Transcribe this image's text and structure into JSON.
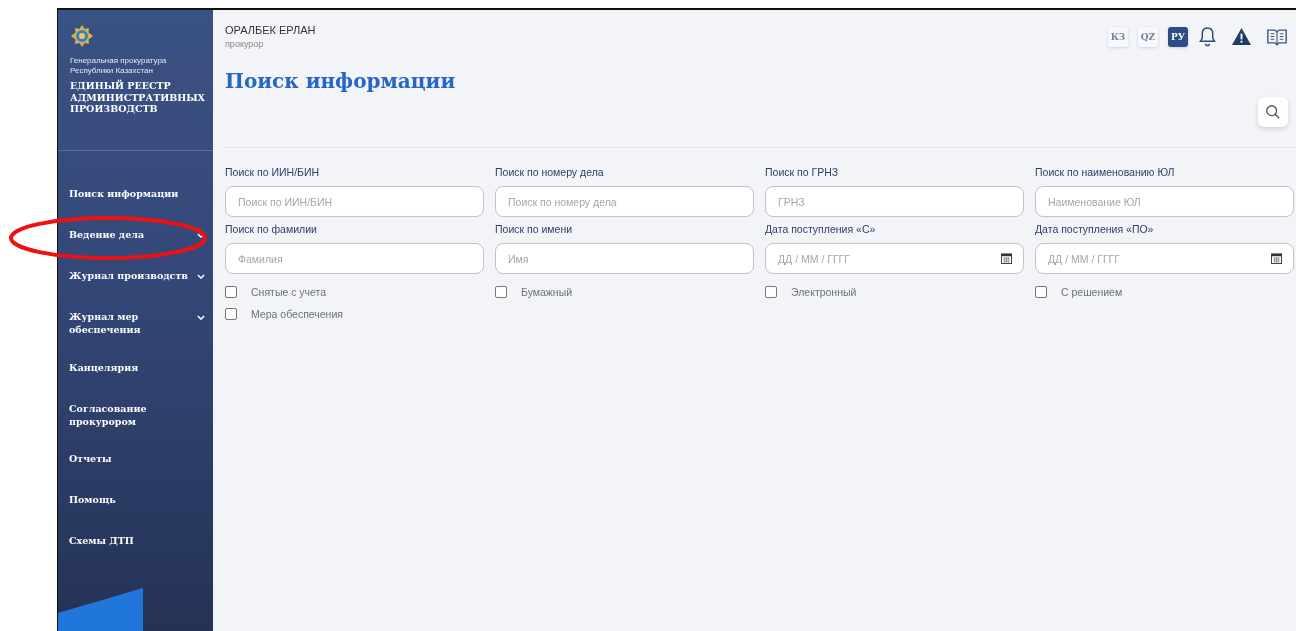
{
  "sidebar": {
    "org": "Генеральная прокуратура Республики Казахстан",
    "system": "ЕДИНЫЙ РЕЕСТР АДМИНИСТРАТИВНЫХ ПРОИЗВОДСТВ",
    "items": [
      {
        "label": "Поиск информации",
        "expandable": false,
        "annotated": false
      },
      {
        "label": "Ведение дела",
        "expandable": true,
        "annotated": true
      },
      {
        "label": "Журнал производств",
        "expandable": true,
        "annotated": false
      },
      {
        "label": "Журнал мер обеспечения",
        "expandable": true,
        "annotated": false
      },
      {
        "label": "Канцелярия",
        "expandable": false,
        "annotated": false
      },
      {
        "label": "Согласование прокурором",
        "expandable": false,
        "annotated": false
      },
      {
        "label": "Отчеты",
        "expandable": false,
        "annotated": false
      },
      {
        "label": "Помощь",
        "expandable": false,
        "annotated": false
      },
      {
        "label": "Схемы ДТП",
        "expandable": false,
        "annotated": false
      }
    ]
  },
  "user": {
    "name": "ОРАЛБЕК ЕРЛАН",
    "role": "прокурор"
  },
  "languages": [
    {
      "label": "КЗ",
      "selected": false
    },
    {
      "label": "QZ",
      "selected": false
    },
    {
      "label": "РУ",
      "selected": true
    }
  ],
  "title": "Поиск информации",
  "fields": [
    {
      "kind": "text",
      "label": "Поиск по ИИН/БИН",
      "placeholder": "Поиск по ИИН/БИН"
    },
    {
      "kind": "text",
      "label": "Поиск по номеру дела",
      "placeholder": "Поиск по номеру дела"
    },
    {
      "kind": "text",
      "label": "Поиск по ГРНЗ",
      "placeholder": "ГРНЗ"
    },
    {
      "kind": "text",
      "label": "Поиск по наименованию ЮЛ",
      "placeholder": "Наименование ЮЛ"
    },
    {
      "kind": "text",
      "label": "Поиск по фамилии",
      "placeholder": "Фамилия"
    },
    {
      "kind": "text",
      "label": "Поиск по имени",
      "placeholder": "Имя"
    },
    {
      "kind": "date",
      "label": "Дата поступления «С»",
      "placeholder": "ДД / ММ / ГГГГ"
    },
    {
      "kind": "date",
      "label": "Дата поступления «ПО»",
      "placeholder": "ДД / ММ / ГГГГ"
    }
  ],
  "checkboxes": [
    {
      "label": "Снятые с учета",
      "checked": false
    },
    {
      "label": "Бумажный",
      "checked": false
    },
    {
      "label": "Электронный",
      "checked": false
    },
    {
      "label": "С решением",
      "checked": false
    },
    {
      "label": "Мера обеспечения",
      "checked": false
    }
  ]
}
